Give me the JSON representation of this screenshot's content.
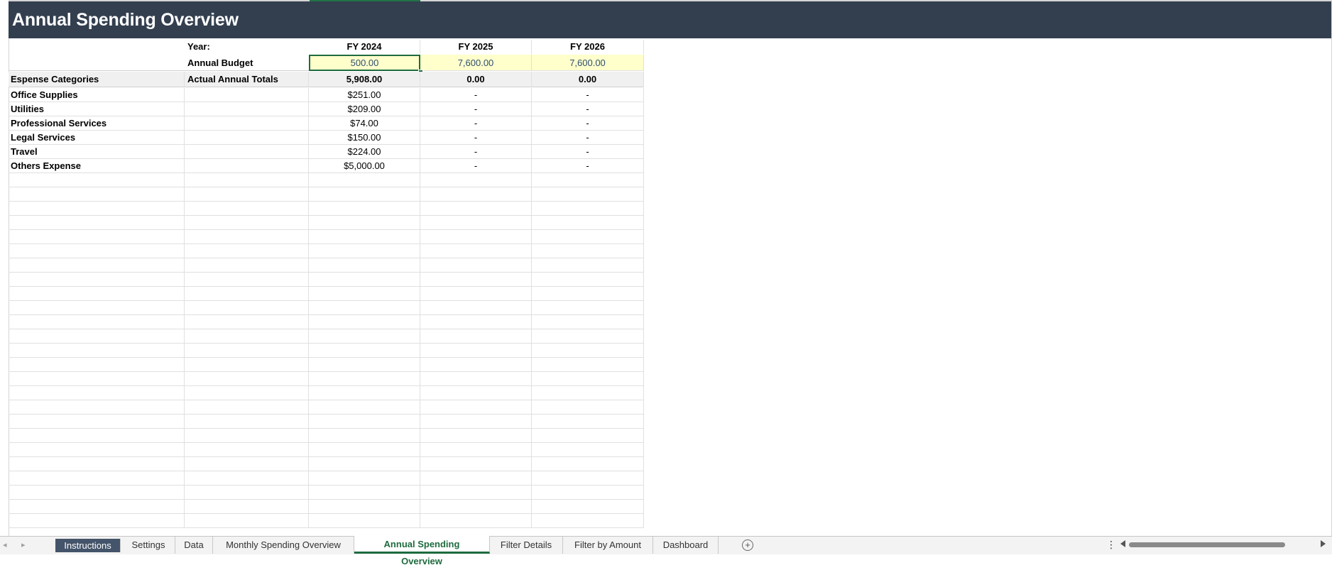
{
  "sheet": {
    "title": "Annual Spending Overview",
    "year_label": "Year:",
    "years": [
      "FY 2024",
      "FY 2025",
      "FY 2026"
    ],
    "budget_label": "Annual Budget",
    "budgets": [
      "500.00",
      "7,600.00",
      "7,600.00"
    ],
    "categories_label": "Espense Categories",
    "totals_label": "Actual Annual Totals",
    "totals": [
      "5,908.00",
      "0.00",
      "0.00"
    ],
    "rows": [
      {
        "category": "Office Supplies",
        "values": [
          "$251.00",
          "-",
          "-"
        ]
      },
      {
        "category": "Utilities",
        "values": [
          "$209.00",
          "-",
          "-"
        ]
      },
      {
        "category": "Professional Services",
        "values": [
          "$74.00",
          "-",
          "-"
        ]
      },
      {
        "category": "Legal Services",
        "values": [
          "$150.00",
          "-",
          "-"
        ]
      },
      {
        "category": "Travel",
        "values": [
          "$224.00",
          "-",
          "-"
        ]
      },
      {
        "category": "Others Expense",
        "values": [
          "$5,000.00",
          "-",
          "-"
        ]
      }
    ]
  },
  "tabs": [
    {
      "label": "Instructions",
      "state": "dark"
    },
    {
      "label": "Settings",
      "state": "normal"
    },
    {
      "label": "Data",
      "state": "normal"
    },
    {
      "label": "Monthly Spending Overview",
      "state": "normal"
    },
    {
      "label": "Annual Spending Overview",
      "state": "active"
    },
    {
      "label": "Filter Details",
      "state": "normal"
    },
    {
      "label": "Filter by Amount",
      "state": "normal"
    },
    {
      "label": "Dashboard",
      "state": "normal"
    }
  ],
  "icons": {
    "prev_sheet": "triangle-left-icon",
    "next_sheet": "triangle-right-icon",
    "add_sheet": "plus-circle-icon",
    "more": "vertical-dots-icon"
  },
  "colors": {
    "banner": "#333f4f",
    "active_tab": "#1e6b3f",
    "budget_fill": "#ffffcc"
  }
}
